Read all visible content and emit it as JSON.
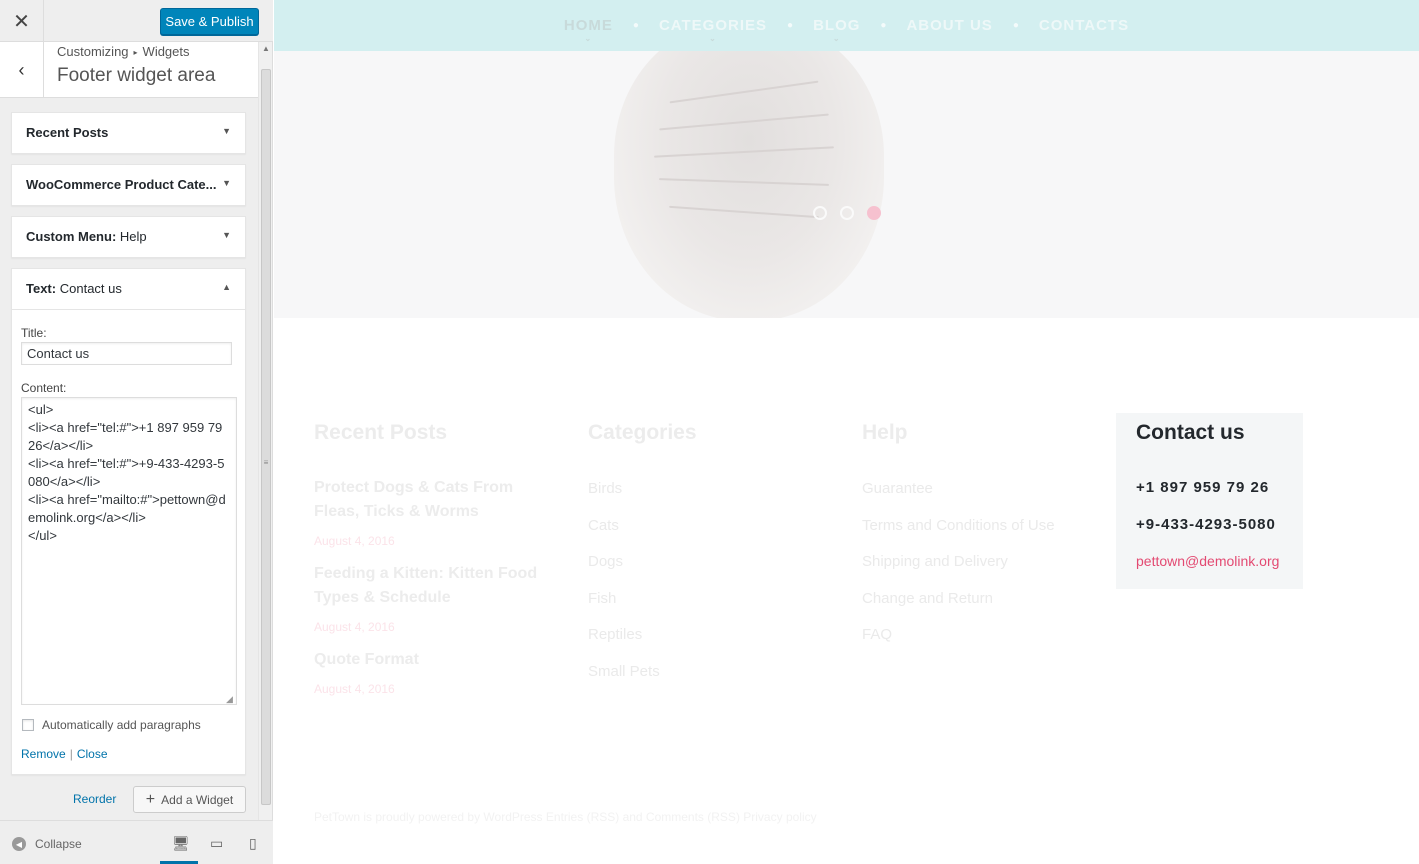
{
  "sidebar": {
    "close_glyph": "✕",
    "save_label": "Save & Publish",
    "back_glyph": "‹",
    "breadcrumb": {
      "root": "Customizing",
      "sep": "▸",
      "leaf": "Widgets"
    },
    "section_title": "Footer widget area",
    "widgets": [
      {
        "title": "Recent Posts",
        "sub": "",
        "arrow": "▼"
      },
      {
        "title": "WooCommerce Product Cate...",
        "sub": "",
        "arrow": "▼"
      },
      {
        "title": "Custom Menu:",
        "sub": "Help",
        "arrow": "▼"
      },
      {
        "title": "Text:",
        "sub": "Contact us",
        "arrow": "▲"
      }
    ],
    "text_widget": {
      "title_label": "Title:",
      "title_value": "Contact us",
      "content_label": "Content:",
      "content_value": "<ul>\n<li><a href=\"tel:#\">+1 897 959 79 26</a></li>\n<li><a href=\"tel:#\">+9-433-4293-5080</a></li>\n<li><a href=\"mailto:#\">pettown@demolink.org</a></li>\n</ul>",
      "auto_paragraphs_label": "Automatically add paragraphs",
      "auto_paragraphs_checked": false,
      "remove_label": "Remove",
      "close_label": "Close"
    },
    "reorder_label": "Reorder",
    "add_widget_label": "Add a Widget",
    "collapse_label": "Collapse"
  },
  "preview": {
    "nav": [
      "HOME",
      "CATEGORIES",
      "BLOG",
      "ABOUT US",
      "CONTACTS"
    ],
    "nav_active": "HOME",
    "slider_dots": [
      false,
      false,
      true
    ],
    "recent_posts": {
      "title": "Recent Posts",
      "posts": [
        {
          "title": "Protect Dogs & Cats From Fleas, Ticks & Worms",
          "date": "August 4, 2016"
        },
        {
          "title": "Feeding a Kitten: Kitten Food Types & Schedule",
          "date": "August 4, 2016"
        },
        {
          "title": "Quote Format",
          "date": "August 4, 2016"
        }
      ]
    },
    "categories": {
      "title": "Categories",
      "items": [
        "Birds",
        "Cats",
        "Dogs",
        "Fish",
        "Reptiles",
        "Small Pets"
      ]
    },
    "help": {
      "title": "Help",
      "items": [
        "Guarantee",
        "Terms and Conditions of Use",
        "Shipping and Delivery",
        "Change and Return",
        "FAQ"
      ]
    },
    "contact": {
      "title": "Contact us",
      "phone1": "+1 897 959 79 26",
      "phone2": "+9-433-4293-5080",
      "email": "pettown@demolink.org"
    },
    "credits": "PetTown is proudly powered by WordPress Entries (RSS) and Comments (RSS) Privacy policy"
  },
  "colors": {
    "primary_button": "#0085ba",
    "link": "#0073aa",
    "nav_bar": "#d3eff0",
    "accent_pink": "#e34a72"
  }
}
